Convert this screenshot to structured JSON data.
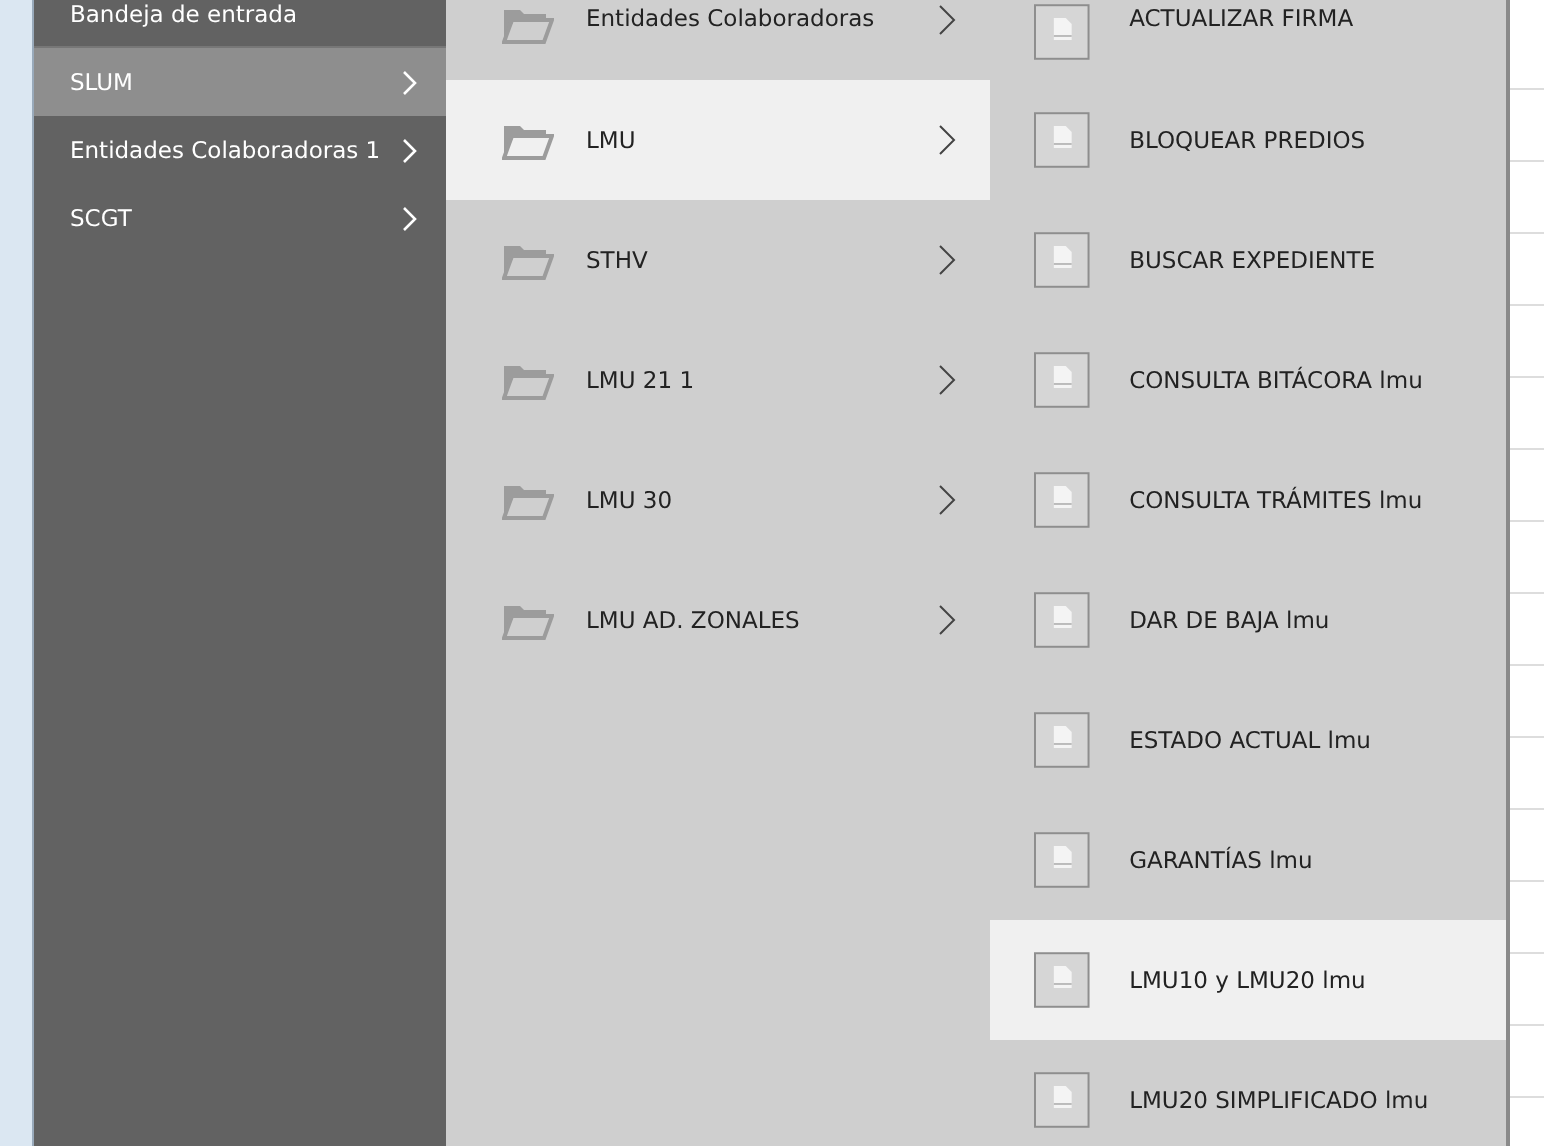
{
  "sidebar": {
    "items": [
      {
        "label": "Bandeja de entrada",
        "selected": false,
        "has_submenu": false
      },
      {
        "label": "SLUM",
        "selected": true,
        "has_submenu": true
      },
      {
        "label": "Entidades Colaboradoras 1",
        "selected": false,
        "has_submenu": true
      },
      {
        "label": "SCGT",
        "selected": false,
        "has_submenu": true
      }
    ]
  },
  "folders": {
    "items": [
      {
        "label": "Entidades Colaboradoras",
        "selected": false
      },
      {
        "label": "LMU",
        "selected": true
      },
      {
        "label": "STHV",
        "selected": false
      },
      {
        "label": "LMU 21 1",
        "selected": false
      },
      {
        "label": "LMU 30",
        "selected": false
      },
      {
        "label": "LMU AD. ZONALES",
        "selected": false
      }
    ]
  },
  "forms": {
    "items": [
      {
        "label": "ACTUALIZAR FIRMA",
        "selected": false
      },
      {
        "label": "BLOQUEAR PREDIOS",
        "selected": false
      },
      {
        "label": "BUSCAR EXPEDIENTE",
        "selected": false
      },
      {
        "label": "CONSULTA BITÁCORA lmu",
        "selected": false
      },
      {
        "label": "CONSULTA TRÁMITES lmu",
        "selected": false
      },
      {
        "label": "DAR DE BAJA lmu",
        "selected": false
      },
      {
        "label": "ESTADO ACTUAL lmu",
        "selected": false
      },
      {
        "label": "GARANTÍAS lmu",
        "selected": false
      },
      {
        "label": "LMU10 y LMU20 lmu",
        "selected": true
      },
      {
        "label": "LMU20 SIMPLIFICADO lmu",
        "selected": false
      }
    ]
  }
}
